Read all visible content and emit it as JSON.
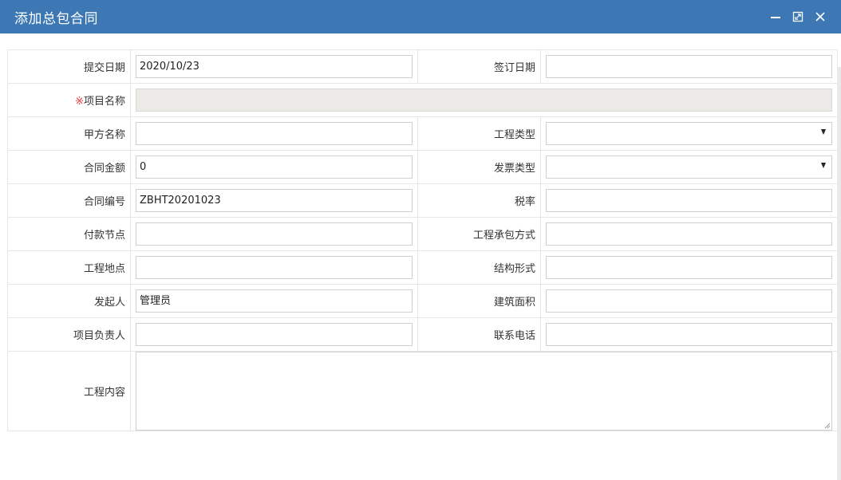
{
  "window": {
    "title": "添加总包合同",
    "icons": {
      "minimize": "minimize-icon",
      "maximize": "maximize-icon",
      "close": "close-icon"
    },
    "colors": {
      "titlebar": "#3d78b5",
      "required": "#e53935",
      "disabled_field": "#ebeae6"
    }
  },
  "form": {
    "submit_date": {
      "label": "提交日期",
      "value": "2020/10/23"
    },
    "sign_date": {
      "label": "签订日期",
      "value": ""
    },
    "project_name": {
      "required_mark": "※",
      "label": "项目名称",
      "value": ""
    },
    "party_a": {
      "label": "甲方名称",
      "value": ""
    },
    "project_type": {
      "label": "工程类型",
      "selected": ""
    },
    "contract_amount": {
      "label": "合同金额",
      "value": "0"
    },
    "invoice_type": {
      "label": "发票类型",
      "selected": ""
    },
    "contract_no": {
      "label": "合同编号",
      "value": "ZBHT20201023"
    },
    "tax_rate": {
      "label": "税率",
      "value": ""
    },
    "payment_node": {
      "label": "付款节点",
      "value": ""
    },
    "contracting_mode": {
      "label": "工程承包方式",
      "value": ""
    },
    "project_location": {
      "label": "工程地点",
      "value": ""
    },
    "structure_form": {
      "label": "结构形式",
      "value": ""
    },
    "initiator": {
      "label": "发起人",
      "value": "管理员"
    },
    "building_area": {
      "label": "建筑面积",
      "value": ""
    },
    "project_manager": {
      "label": "项目负责人",
      "value": ""
    },
    "contact_phone": {
      "label": "联系电话",
      "value": ""
    },
    "project_content": {
      "label": "工程内容",
      "value": ""
    }
  }
}
